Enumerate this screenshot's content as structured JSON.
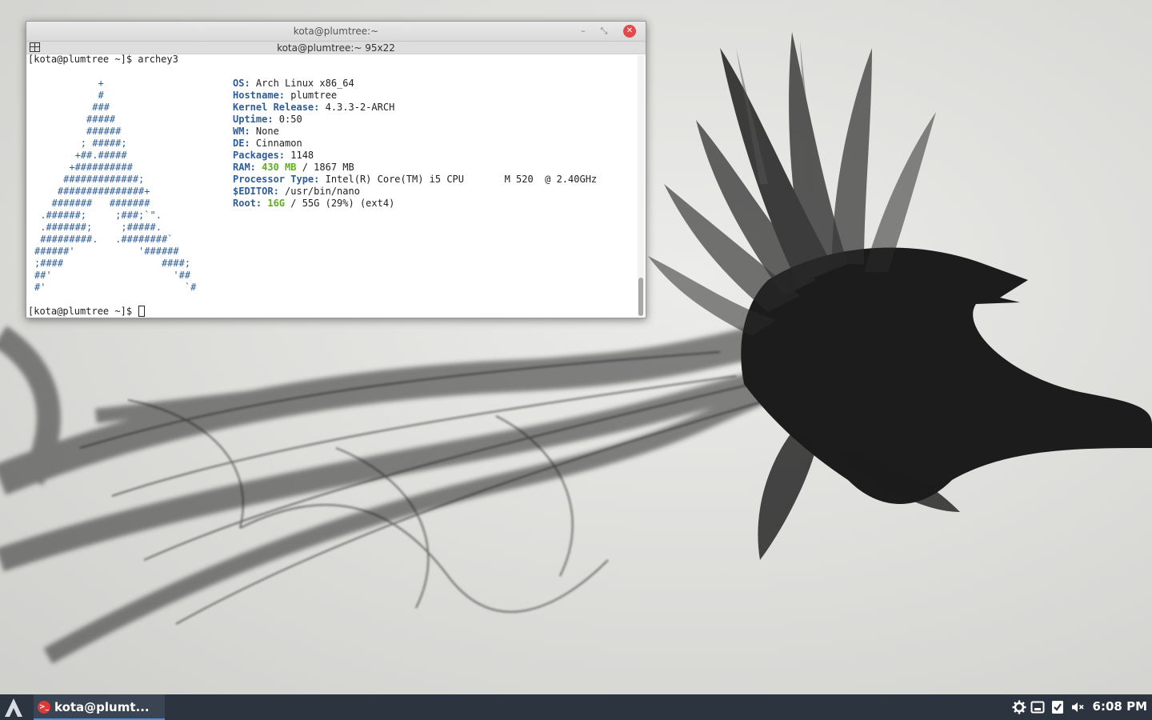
{
  "window": {
    "title": "kota@plumtree:~",
    "info": "kota@plumtree:~ 95x22",
    "minimize_glyph": "–",
    "maximize_glyph": "⤡",
    "close_glyph": "✕"
  },
  "terminal": {
    "command_line": "[kota@plumtree ~]$ archey3",
    "prompt": "[kota@plumtree ~]$ ",
    "logo": "           +\n           #\n          ###\n         #####\n         ######\n        ; #####;\n       +##.#####\n      +##########\n     #############;\n    ###############+\n   #######   #######\n .######;     ;###;`\".\n .#######;     ;#####.\n #########.   .########`\n######'           '######\n;####                 ####;\n##'                     '##\n#'                        `#",
    "sysinfo": [
      {
        "label": "OS:",
        "value": " Arch Linux x86_64"
      },
      {
        "label": "Hostname:",
        "value": " plumtree"
      },
      {
        "label": "Kernel Release:",
        "value": " 4.3.3-2-ARCH"
      },
      {
        "label": "Uptime:",
        "value": " 0:50"
      },
      {
        "label": "WM:",
        "value": " None"
      },
      {
        "label": "DE:",
        "value": " Cinnamon"
      },
      {
        "label": "Packages:",
        "value": " 1148"
      },
      {
        "label": "RAM:",
        "highlight": " 430 MB",
        "value": " / 1867 MB"
      },
      {
        "label": "Processor Type:",
        "value": " Intel(R) Core(TM) i5 CPU       M 520  @ 2.40GHz"
      },
      {
        "label": "$EDITOR:",
        "value": " /usr/bin/nano"
      },
      {
        "label": "Root:",
        "highlight": " 16G",
        "value": " / 55G (29%) (ext4)"
      }
    ]
  },
  "taskbar": {
    "task_label": "kota@plumt...",
    "clock": "6:08 PM",
    "tray_icons": [
      "settings-gear-icon",
      "removable-drive-icon",
      "update-check-icon",
      "volume-muted-icon"
    ]
  },
  "colors": {
    "label_blue": "#2f5d98",
    "highlight_green": "#5eae23",
    "taskbar_bg": "#2c3440",
    "close_red": "#e34949"
  }
}
